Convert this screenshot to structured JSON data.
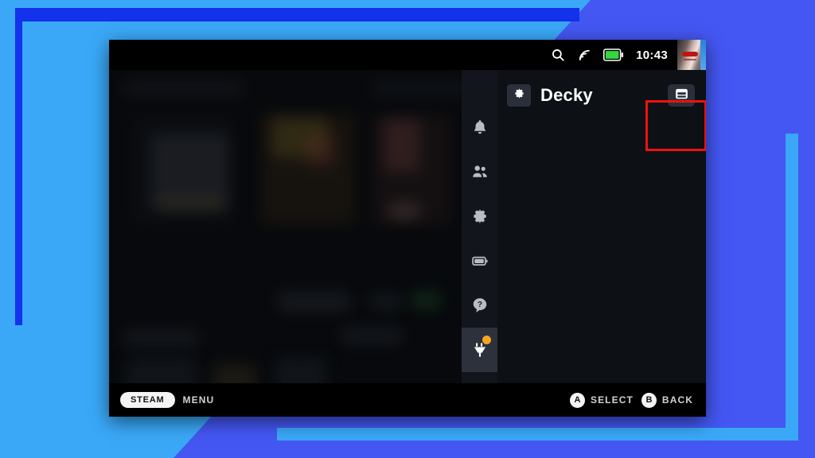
{
  "backdrop": {
    "base_color": "#3aa8f7",
    "wedge_color": "#4457f2",
    "frame_dark_color": "#1432ec",
    "frame_light_color": "#3aa8f7"
  },
  "device": {
    "status_bar": {
      "search_icon": "search-icon",
      "wifi_icon": "wifi-icon",
      "battery_icon": "battery-icon",
      "battery_color": "#35d63f",
      "clock": "10:43",
      "avatar": "user-avatar"
    },
    "background": {
      "description": "dimmed steam game library"
    },
    "quick_access": {
      "rail_items": [
        {
          "name": "notifications",
          "icon": "bell-icon",
          "selected": false,
          "badge": false
        },
        {
          "name": "friends-and-chat",
          "icon": "friends-icon",
          "selected": false,
          "badge": false
        },
        {
          "name": "settings",
          "icon": "gear-icon",
          "selected": false,
          "badge": false
        },
        {
          "name": "performance",
          "icon": "battery-icon",
          "selected": false,
          "badge": false
        },
        {
          "name": "help-and-tips",
          "icon": "help-icon",
          "selected": false,
          "badge": false
        },
        {
          "name": "decky-loader",
          "icon": "plug-icon",
          "selected": true,
          "badge": true
        }
      ],
      "badge_color": "#f5a524",
      "panel": {
        "settings_button_icon": "gear-icon",
        "title": "Decky",
        "store_button_icon": "store-icon"
      },
      "highlight": {
        "target": "store-button",
        "color": "#ee1111"
      }
    },
    "footer": {
      "steam_pill": "STEAM",
      "menu_label": "MENU",
      "hints": [
        {
          "glyph": "A",
          "label": "SELECT"
        },
        {
          "glyph": "B",
          "label": "BACK"
        }
      ]
    }
  }
}
